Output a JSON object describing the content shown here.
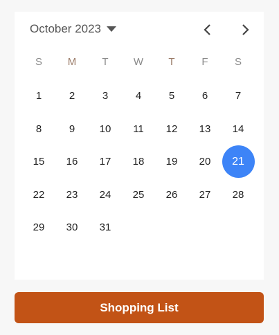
{
  "calendar": {
    "month_label": "October 2023",
    "weekdays": [
      "S",
      "M",
      "T",
      "W",
      "T",
      "F",
      "S"
    ],
    "leading_blanks": 0,
    "days": [
      "1",
      "2",
      "3",
      "4",
      "5",
      "6",
      "7",
      "8",
      "9",
      "10",
      "11",
      "12",
      "13",
      "14",
      "15",
      "16",
      "17",
      "18",
      "19",
      "20",
      "21",
      "22",
      "23",
      "24",
      "25",
      "26",
      "27",
      "28",
      "29",
      "30",
      "31"
    ],
    "selected_day": "21",
    "selected_color": "#3d84f7"
  },
  "button": {
    "label": "Shopping List",
    "color": "#c25316"
  }
}
